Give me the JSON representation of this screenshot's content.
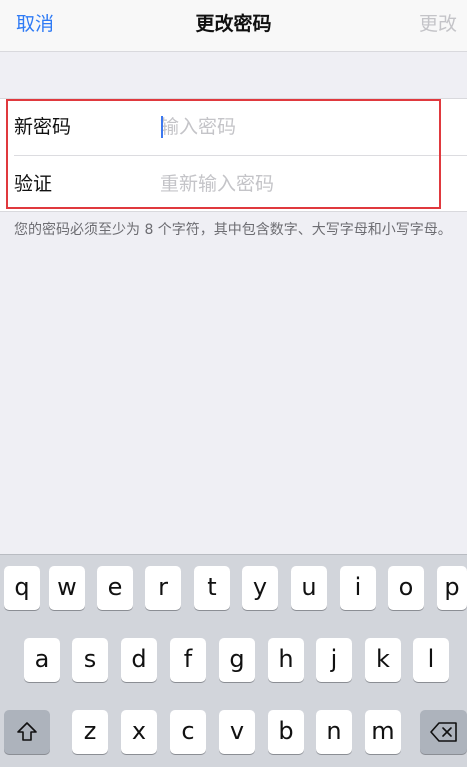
{
  "nav": {
    "cancel_label": "取消",
    "title": "更改密码",
    "done_label": "更改"
  },
  "form": {
    "new_password": {
      "label": "新密码",
      "value": "",
      "placeholder": "输入密码"
    },
    "verify": {
      "label": "验证",
      "value": "",
      "placeholder": "重新输入密码"
    }
  },
  "hint": "您的密码必须至少为 8 个字符，其中包含数字、大写字母和小写字母。",
  "keyboard": {
    "row1": [
      "q",
      "w",
      "e",
      "r",
      "t",
      "y",
      "u",
      "i",
      "o",
      "p"
    ],
    "row2": [
      "a",
      "s",
      "d",
      "f",
      "g",
      "h",
      "j",
      "k",
      "l"
    ],
    "row3": [
      "z",
      "x",
      "c",
      "v",
      "b",
      "n",
      "m"
    ],
    "shift_icon": "shift-icon",
    "delete_icon": "delete-icon"
  },
  "colors": {
    "accent": "#2f7bf5",
    "disabled": "#c4c4c8",
    "highlight": "#e0393e",
    "background": "#efeff4",
    "keyboard_bg": "#d2d5db"
  }
}
